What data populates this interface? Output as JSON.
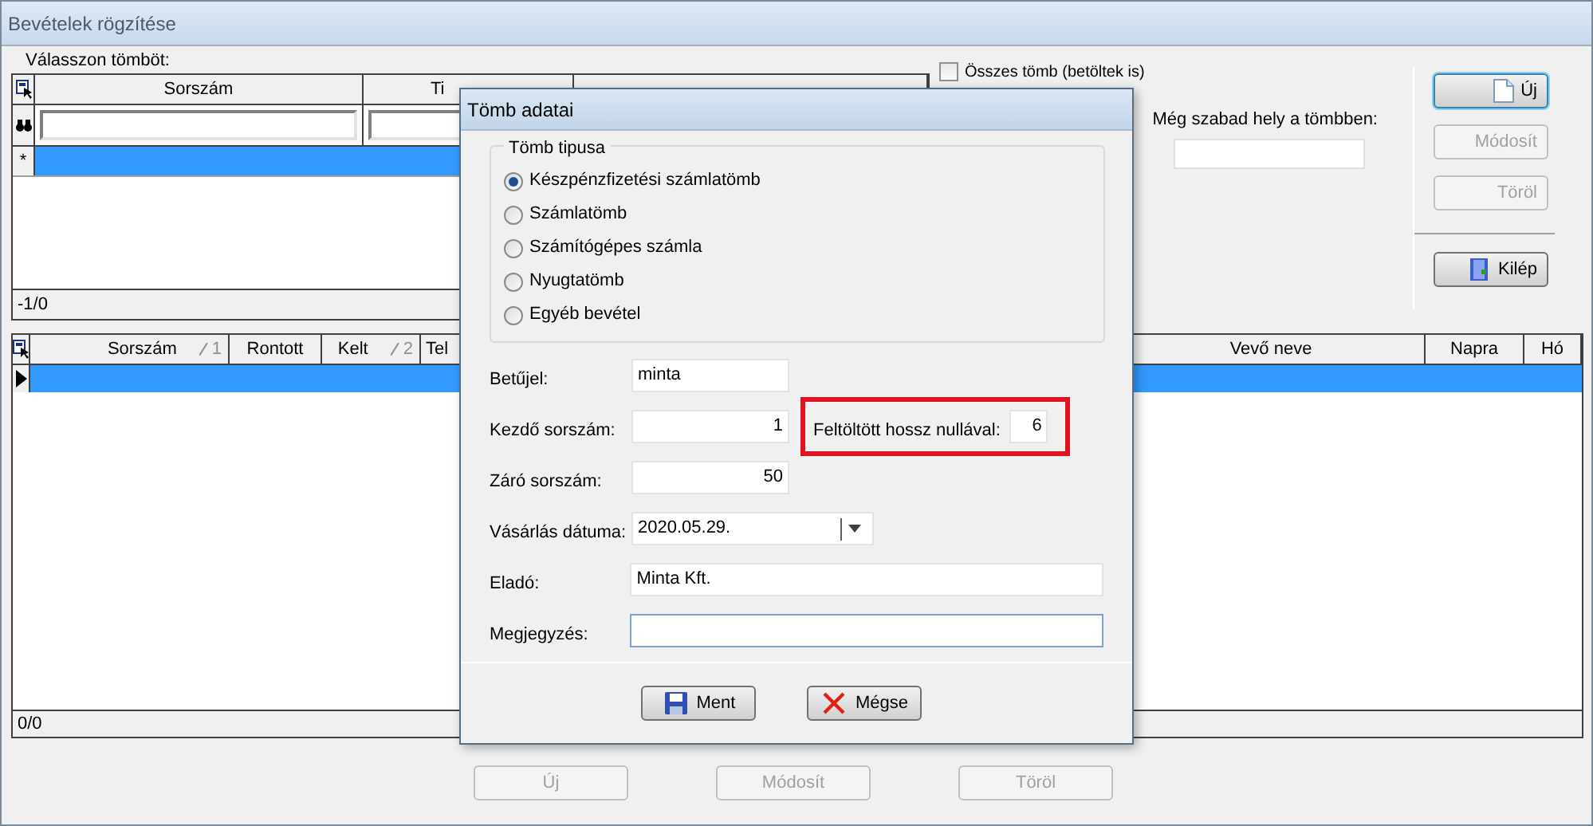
{
  "window": {
    "title": "Bevételek rögzítése"
  },
  "block_picker": {
    "label": "Válasszon tömböt:",
    "columns": [
      {
        "label": "Sorszám"
      },
      {
        "label": "Ti"
      }
    ],
    "rows": [
      {
        "selected": true,
        "marker": "*"
      }
    ],
    "footer": "-1/0"
  },
  "show_all_checkbox": {
    "label": "Összes tömb (betöltek is)",
    "checked": false
  },
  "free_space": {
    "label": "Még szabad hely a tömbben:"
  },
  "side_buttons": [
    {
      "label": "Új",
      "disabled": false,
      "default": true
    },
    {
      "label": "Módosít",
      "disabled": true,
      "default": false
    },
    {
      "label": "Töröl",
      "disabled": true,
      "default": false
    },
    {
      "label": "Kilép",
      "disabled": false,
      "default": false
    }
  ],
  "entries_grid": {
    "columns": [
      {
        "label": "Sorszám",
        "sort": "1"
      },
      {
        "label": "Rontott"
      },
      {
        "label": "Kelt",
        "sort": "2"
      },
      {
        "label": "Tel"
      },
      {
        "label": "Vevő neve"
      },
      {
        "label": "Napra"
      },
      {
        "label": "Hó"
      }
    ],
    "rows": [
      {
        "selected": true
      }
    ],
    "footer": "0/0"
  },
  "bottom_buttons": [
    {
      "label": "Új",
      "disabled": true
    },
    {
      "label": "Módosít",
      "disabled": true
    },
    {
      "label": "Töröl",
      "disabled": true
    }
  ],
  "dialog": {
    "title": "Tömb adatai",
    "group": {
      "title": "Tömb tipusa",
      "options": [
        {
          "label": "Készpénzfizetési számlatömb",
          "selected": true
        },
        {
          "label": "Számlatömb",
          "selected": false
        },
        {
          "label": "Számítógépes számla",
          "selected": false
        },
        {
          "label": "Nyugtatömb",
          "selected": false
        },
        {
          "label": "Egyéb bevétel",
          "selected": false
        }
      ]
    },
    "fields": [
      {
        "label": "Betűjel:",
        "kind": "text",
        "value": "minta"
      },
      {
        "label": "Kezdő sorszám:",
        "kind": "number",
        "value": "1",
        "padding": {
          "label": "Feltöltött hossz nullával:",
          "value": "6",
          "highlighted": true
        }
      },
      {
        "label": "Záró sorszám:",
        "kind": "number",
        "value": "50"
      },
      {
        "label": "Vásárlás dátuma:",
        "kind": "date",
        "value": "2020.05.29."
      },
      {
        "label": "Eladó:",
        "kind": "wide",
        "value": "Minta Kft."
      },
      {
        "label": "Megjegyzés:",
        "kind": "wide",
        "focused": true
      }
    ],
    "buttons": [
      {
        "label": "Ment"
      },
      {
        "label": "Mégse"
      }
    ]
  }
}
